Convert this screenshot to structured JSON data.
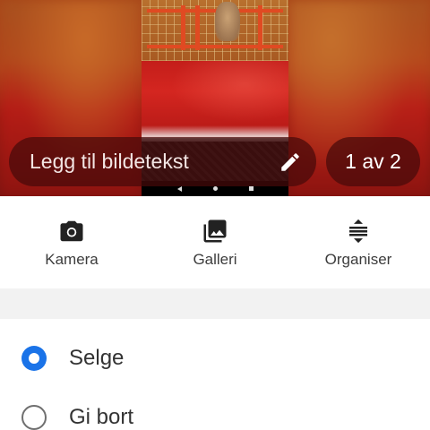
{
  "photo": {
    "caption_placeholder": "Legg til bildetekst",
    "counter": "1 av 2"
  },
  "toolbar": {
    "camera_label": "Kamera",
    "gallery_label": "Galleri",
    "organize_label": "Organiser"
  },
  "options": {
    "sell_label": "Selge",
    "sell_selected": true,
    "give_label": "Gi bort",
    "give_selected": false
  },
  "colors": {
    "accent": "#1a73e8",
    "pill_background": "#460a0a",
    "icon": "#222222"
  }
}
